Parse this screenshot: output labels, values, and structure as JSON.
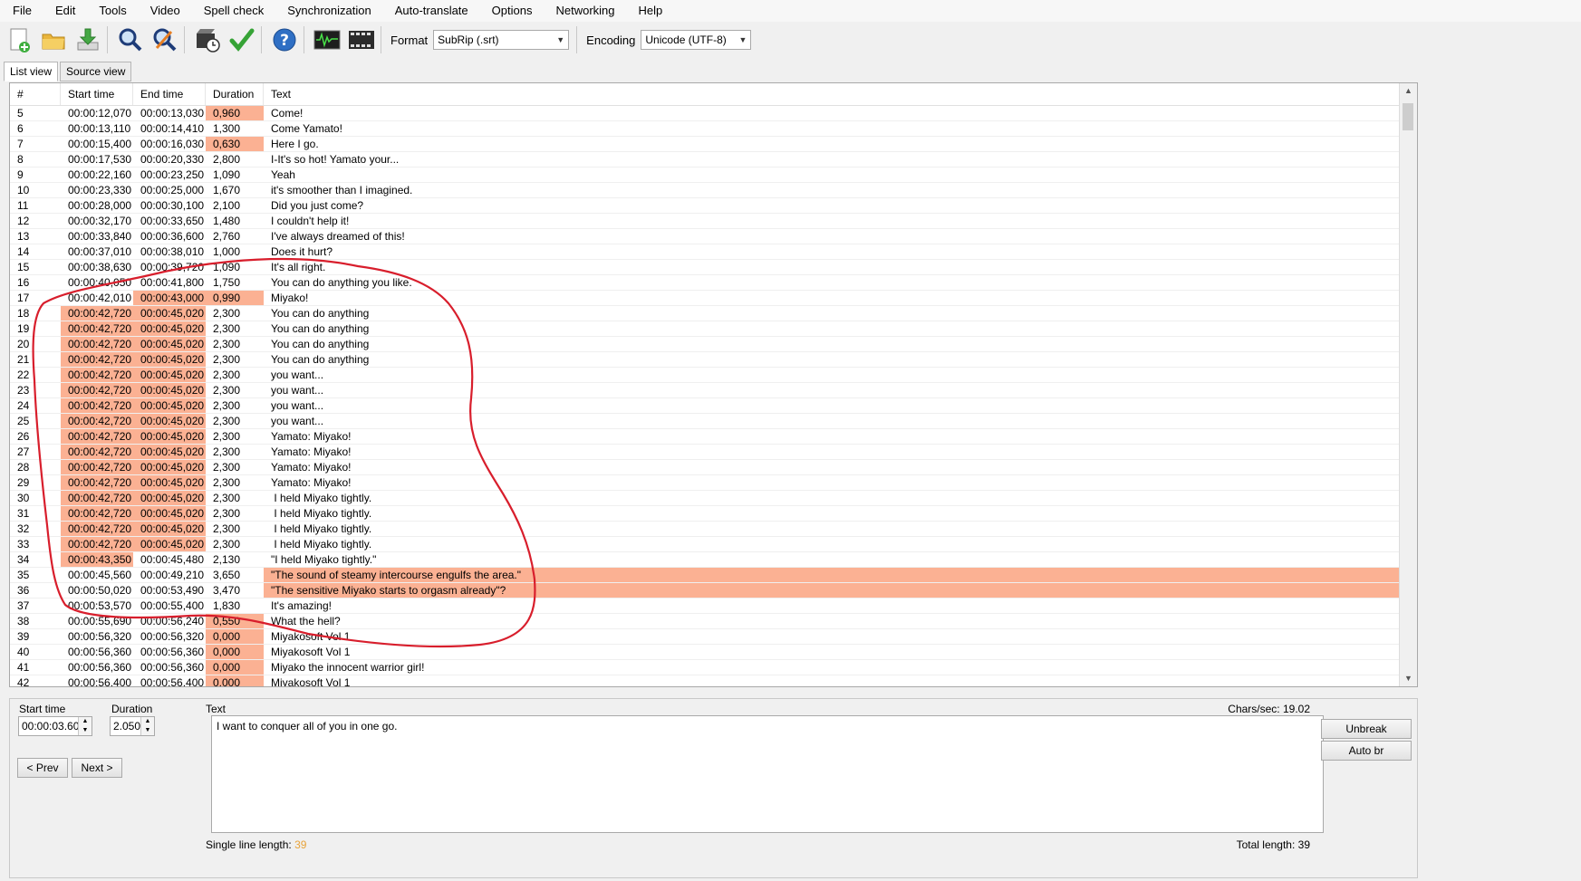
{
  "menu": [
    "File",
    "Edit",
    "Tools",
    "Video",
    "Spell check",
    "Synchronization",
    "Auto-translate",
    "Options",
    "Networking",
    "Help"
  ],
  "toolbar": {
    "buttons": [
      "new-file-icon",
      "open-folder-icon",
      "save-download-icon",
      "find-icon",
      "replace-icon",
      "visual-sync-icon",
      "spell-check-icon",
      "help-icon",
      "waveform-icon",
      "video-icon"
    ],
    "format_label": "Format",
    "format_value": "SubRip (.srt)",
    "encoding_label": "Encoding",
    "encoding_value": "Unicode (UTF-8)"
  },
  "tabs": [
    "List view",
    "Source view"
  ],
  "list": {
    "headers": [
      "#",
      "Start time",
      "End time",
      "Duration",
      "Text"
    ],
    "highlight_color": "#fbb193",
    "rows": [
      {
        "num": "5",
        "start": "00:00:12,070",
        "end": "00:00:13,030",
        "dur": "0,960",
        "text": "Come!",
        "hl": [
          "dur"
        ]
      },
      {
        "num": "6",
        "start": "00:00:13,110",
        "end": "00:00:14,410",
        "dur": "1,300",
        "text": "Come Yamato!",
        "hl": []
      },
      {
        "num": "7",
        "start": "00:00:15,400",
        "end": "00:00:16,030",
        "dur": "0,630",
        "text": "Here I go.",
        "hl": [
          "dur"
        ]
      },
      {
        "num": "8",
        "start": "00:00:17,530",
        "end": "00:00:20,330",
        "dur": "2,800",
        "text": "I-It's so hot! Yamato your...",
        "hl": []
      },
      {
        "num": "9",
        "start": "00:00:22,160",
        "end": "00:00:23,250",
        "dur": "1,090",
        "text": "Yeah",
        "hl": []
      },
      {
        "num": "10",
        "start": "00:00:23,330",
        "end": "00:00:25,000",
        "dur": "1,670",
        "text": "it's smoother than I imagined.",
        "hl": []
      },
      {
        "num": "11",
        "start": "00:00:28,000",
        "end": "00:00:30,100",
        "dur": "2,100",
        "text": "Did you just come?",
        "hl": []
      },
      {
        "num": "12",
        "start": "00:00:32,170",
        "end": "00:00:33,650",
        "dur": "1,480",
        "text": "I couldn't help it!",
        "hl": []
      },
      {
        "num": "13",
        "start": "00:00:33,840",
        "end": "00:00:36,600",
        "dur": "2,760",
        "text": "I've always dreamed of this!",
        "hl": []
      },
      {
        "num": "14",
        "start": "00:00:37,010",
        "end": "00:00:38,010",
        "dur": "1,000",
        "text": "Does it hurt?",
        "hl": []
      },
      {
        "num": "15",
        "start": "00:00:38,630",
        "end": "00:00:39,720",
        "dur": "1,090",
        "text": "It's all right.",
        "hl": []
      },
      {
        "num": "16",
        "start": "00:00:40,050",
        "end": "00:00:41,800",
        "dur": "1,750",
        "text": "You can do anything you like.",
        "hl": []
      },
      {
        "num": "17",
        "start": "00:00:42,010",
        "end": "00:00:43,000",
        "dur": "0,990",
        "text": "Miyako!",
        "hl": [
          "end",
          "dur"
        ]
      },
      {
        "num": "18",
        "start": "00:00:42,720",
        "end": "00:00:45,020",
        "dur": "2,300",
        "text": "You can do anything",
        "hl": [
          "start",
          "end"
        ]
      },
      {
        "num": "19",
        "start": "00:00:42,720",
        "end": "00:00:45,020",
        "dur": "2,300",
        "text": "You can do anything",
        "hl": [
          "start",
          "end"
        ]
      },
      {
        "num": "20",
        "start": "00:00:42,720",
        "end": "00:00:45,020",
        "dur": "2,300",
        "text": "You can do anything",
        "hl": [
          "start",
          "end"
        ]
      },
      {
        "num": "21",
        "start": "00:00:42,720",
        "end": "00:00:45,020",
        "dur": "2,300",
        "text": "You can do anything",
        "hl": [
          "start",
          "end"
        ]
      },
      {
        "num": "22",
        "start": "00:00:42,720",
        "end": "00:00:45,020",
        "dur": "2,300",
        "text": "you want...",
        "hl": [
          "start",
          "end"
        ]
      },
      {
        "num": "23",
        "start": "00:00:42,720",
        "end": "00:00:45,020",
        "dur": "2,300",
        "text": "you want...",
        "hl": [
          "start",
          "end"
        ]
      },
      {
        "num": "24",
        "start": "00:00:42,720",
        "end": "00:00:45,020",
        "dur": "2,300",
        "text": "you want...",
        "hl": [
          "start",
          "end"
        ]
      },
      {
        "num": "25",
        "start": "00:00:42,720",
        "end": "00:00:45,020",
        "dur": "2,300",
        "text": "you want...",
        "hl": [
          "start",
          "end"
        ]
      },
      {
        "num": "26",
        "start": "00:00:42,720",
        "end": "00:00:45,020",
        "dur": "2,300",
        "text": "Yamato: Miyako!",
        "hl": [
          "start",
          "end"
        ]
      },
      {
        "num": "27",
        "start": "00:00:42,720",
        "end": "00:00:45,020",
        "dur": "2,300",
        "text": "Yamato: Miyako!",
        "hl": [
          "start",
          "end"
        ]
      },
      {
        "num": "28",
        "start": "00:00:42,720",
        "end": "00:00:45,020",
        "dur": "2,300",
        "text": "Yamato: Miyako!",
        "hl": [
          "start",
          "end"
        ]
      },
      {
        "num": "29",
        "start": "00:00:42,720",
        "end": "00:00:45,020",
        "dur": "2,300",
        "text": "Yamato: Miyako!",
        "hl": [
          "start",
          "end"
        ]
      },
      {
        "num": "30",
        "start": "00:00:42,720",
        "end": "00:00:45,020",
        "dur": "2,300",
        "text": " I held Miyako tightly.",
        "hl": [
          "start",
          "end"
        ]
      },
      {
        "num": "31",
        "start": "00:00:42,720",
        "end": "00:00:45,020",
        "dur": "2,300",
        "text": " I held Miyako tightly.",
        "hl": [
          "start",
          "end"
        ]
      },
      {
        "num": "32",
        "start": "00:00:42,720",
        "end": "00:00:45,020",
        "dur": "2,300",
        "text": " I held Miyako tightly.",
        "hl": [
          "start",
          "end"
        ]
      },
      {
        "num": "33",
        "start": "00:00:42,720",
        "end": "00:00:45,020",
        "dur": "2,300",
        "text": " I held Miyako tightly.",
        "hl": [
          "start",
          "end"
        ]
      },
      {
        "num": "34",
        "start": "00:00:43,350",
        "end": "00:00:45,480",
        "dur": "2,130",
        "text": "\"I held Miyako tightly.\"",
        "hl": [
          "start"
        ]
      },
      {
        "num": "35",
        "start": "00:00:45,560",
        "end": "00:00:49,210",
        "dur": "3,650",
        "text": "\"The sound of steamy intercourse engulfs the area.\"",
        "hl": [
          "text"
        ]
      },
      {
        "num": "36",
        "start": "00:00:50,020",
        "end": "00:00:53,490",
        "dur": "3,470",
        "text": "\"The sensitive Miyako starts to orgasm already\"?",
        "hl": [
          "text"
        ]
      },
      {
        "num": "37",
        "start": "00:00:53,570",
        "end": "00:00:55,400",
        "dur": "1,830",
        "text": "It's amazing!",
        "hl": []
      },
      {
        "num": "38",
        "start": "00:00:55,690",
        "end": "00:00:56,240",
        "dur": "0,550",
        "text": "What the hell?",
        "hl": [
          "dur"
        ]
      },
      {
        "num": "39",
        "start": "00:00:56,320",
        "end": "00:00:56,320",
        "dur": "0,000",
        "text": "Miyakosoft Vol 1",
        "hl": [
          "dur"
        ]
      },
      {
        "num": "40",
        "start": "00:00:56,360",
        "end": "00:00:56,360",
        "dur": "0,000",
        "text": "Miyakosoft Vol 1",
        "hl": [
          "dur"
        ]
      },
      {
        "num": "41",
        "start": "00:00:56,360",
        "end": "00:00:56,360",
        "dur": "0,000",
        "text": "Miyako the innocent warrior girl!",
        "hl": [
          "dur"
        ]
      },
      {
        "num": "42",
        "start": "00:00:56,400",
        "end": "00:00:56,400",
        "dur": "0,000",
        "text": "Miyakosoft Vol 1",
        "hl": [
          "dur"
        ]
      }
    ]
  },
  "annotation": {
    "stroke_color": "#d81e2c"
  },
  "edit": {
    "start_time_label": "Start time",
    "start_time_value": "00:00:03.600",
    "duration_label": "Duration",
    "duration_value": "2.050",
    "prev_label": "< Prev",
    "next_label": "Next >",
    "text_label": "Text",
    "chars_sec": "Chars/sec: 19.02",
    "text_value": "I want to conquer all of you in one go.",
    "single_line_label": "Single line length:",
    "single_line_value": "39",
    "total_length": "Total length: 39",
    "unbreak_label": "Unbreak",
    "autobr_label": "Auto br"
  }
}
